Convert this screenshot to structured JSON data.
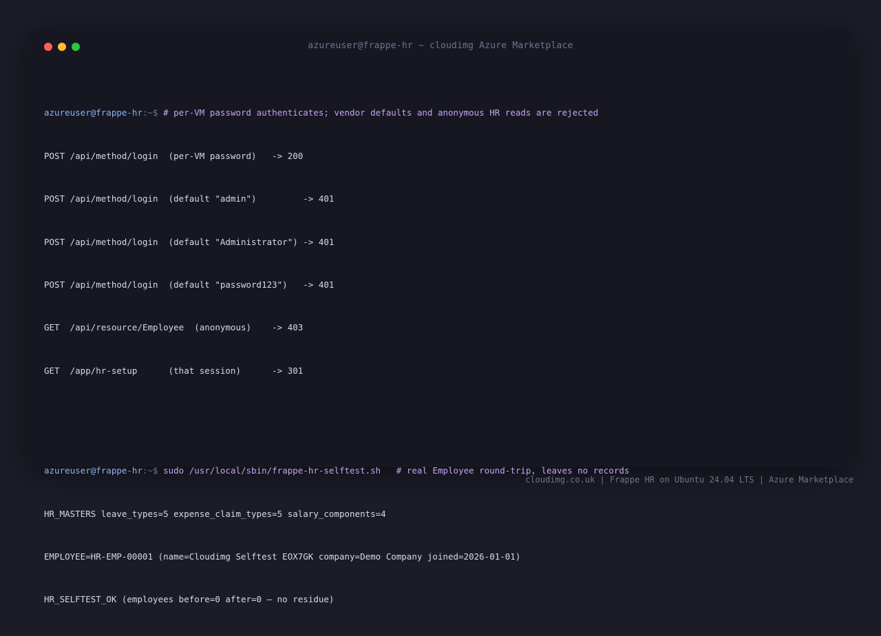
{
  "window": {
    "title": "azureuser@frappe-hr ~ cloudimg Azure Marketplace"
  },
  "terminal": {
    "blocks": [
      {
        "prompt_user": "azureuser@frappe-hr",
        "prompt_sep": ":~$ ",
        "command": "# per-VM password authenticates; vendor defaults and anonymous HR reads are rejected",
        "output": [
          "POST /api/method/login  (per-VM password)   -> 200",
          "POST /api/method/login  (default \"admin\")         -> 401",
          "POST /api/method/login  (default \"Administrator\") -> 401",
          "POST /api/method/login  (default \"password123\")   -> 401",
          "GET  /api/resource/Employee  (anonymous)    -> 403",
          "GET  /app/hr-setup      (that session)      -> 301"
        ]
      },
      {
        "prompt_user": "azureuser@frappe-hr",
        "prompt_sep": ":~$ ",
        "command": "sudo /usr/local/sbin/frappe-hr-selftest.sh   # real Employee round-trip, leaves no records",
        "output": [
          "HR_MASTERS leave_types=5 expense_claim_types=5 salary_components=4",
          "EMPLOYEE=HR-EMP-00001 (name=Cloudimg Selftest EOX7GK company=Demo Company joined=2026-01-01)",
          "HR_SELFTEST_OK (employees before=0 after=0 — no residue)"
        ]
      }
    ]
  },
  "footer": {
    "text": "cloudimg.co.uk | Frappe HR on Ubuntu 24.04 LTS | Azure Marketplace"
  },
  "colors": {
    "background": "#1b1c26",
    "window": "#161721",
    "prompt_user": "#89b4fa",
    "command": "#c7a3f5",
    "output": "#d7d9e4",
    "muted": "#6f7591"
  },
  "icons": [
    "close-dot-icon",
    "minimize-dot-icon",
    "maximize-dot-icon"
  ]
}
